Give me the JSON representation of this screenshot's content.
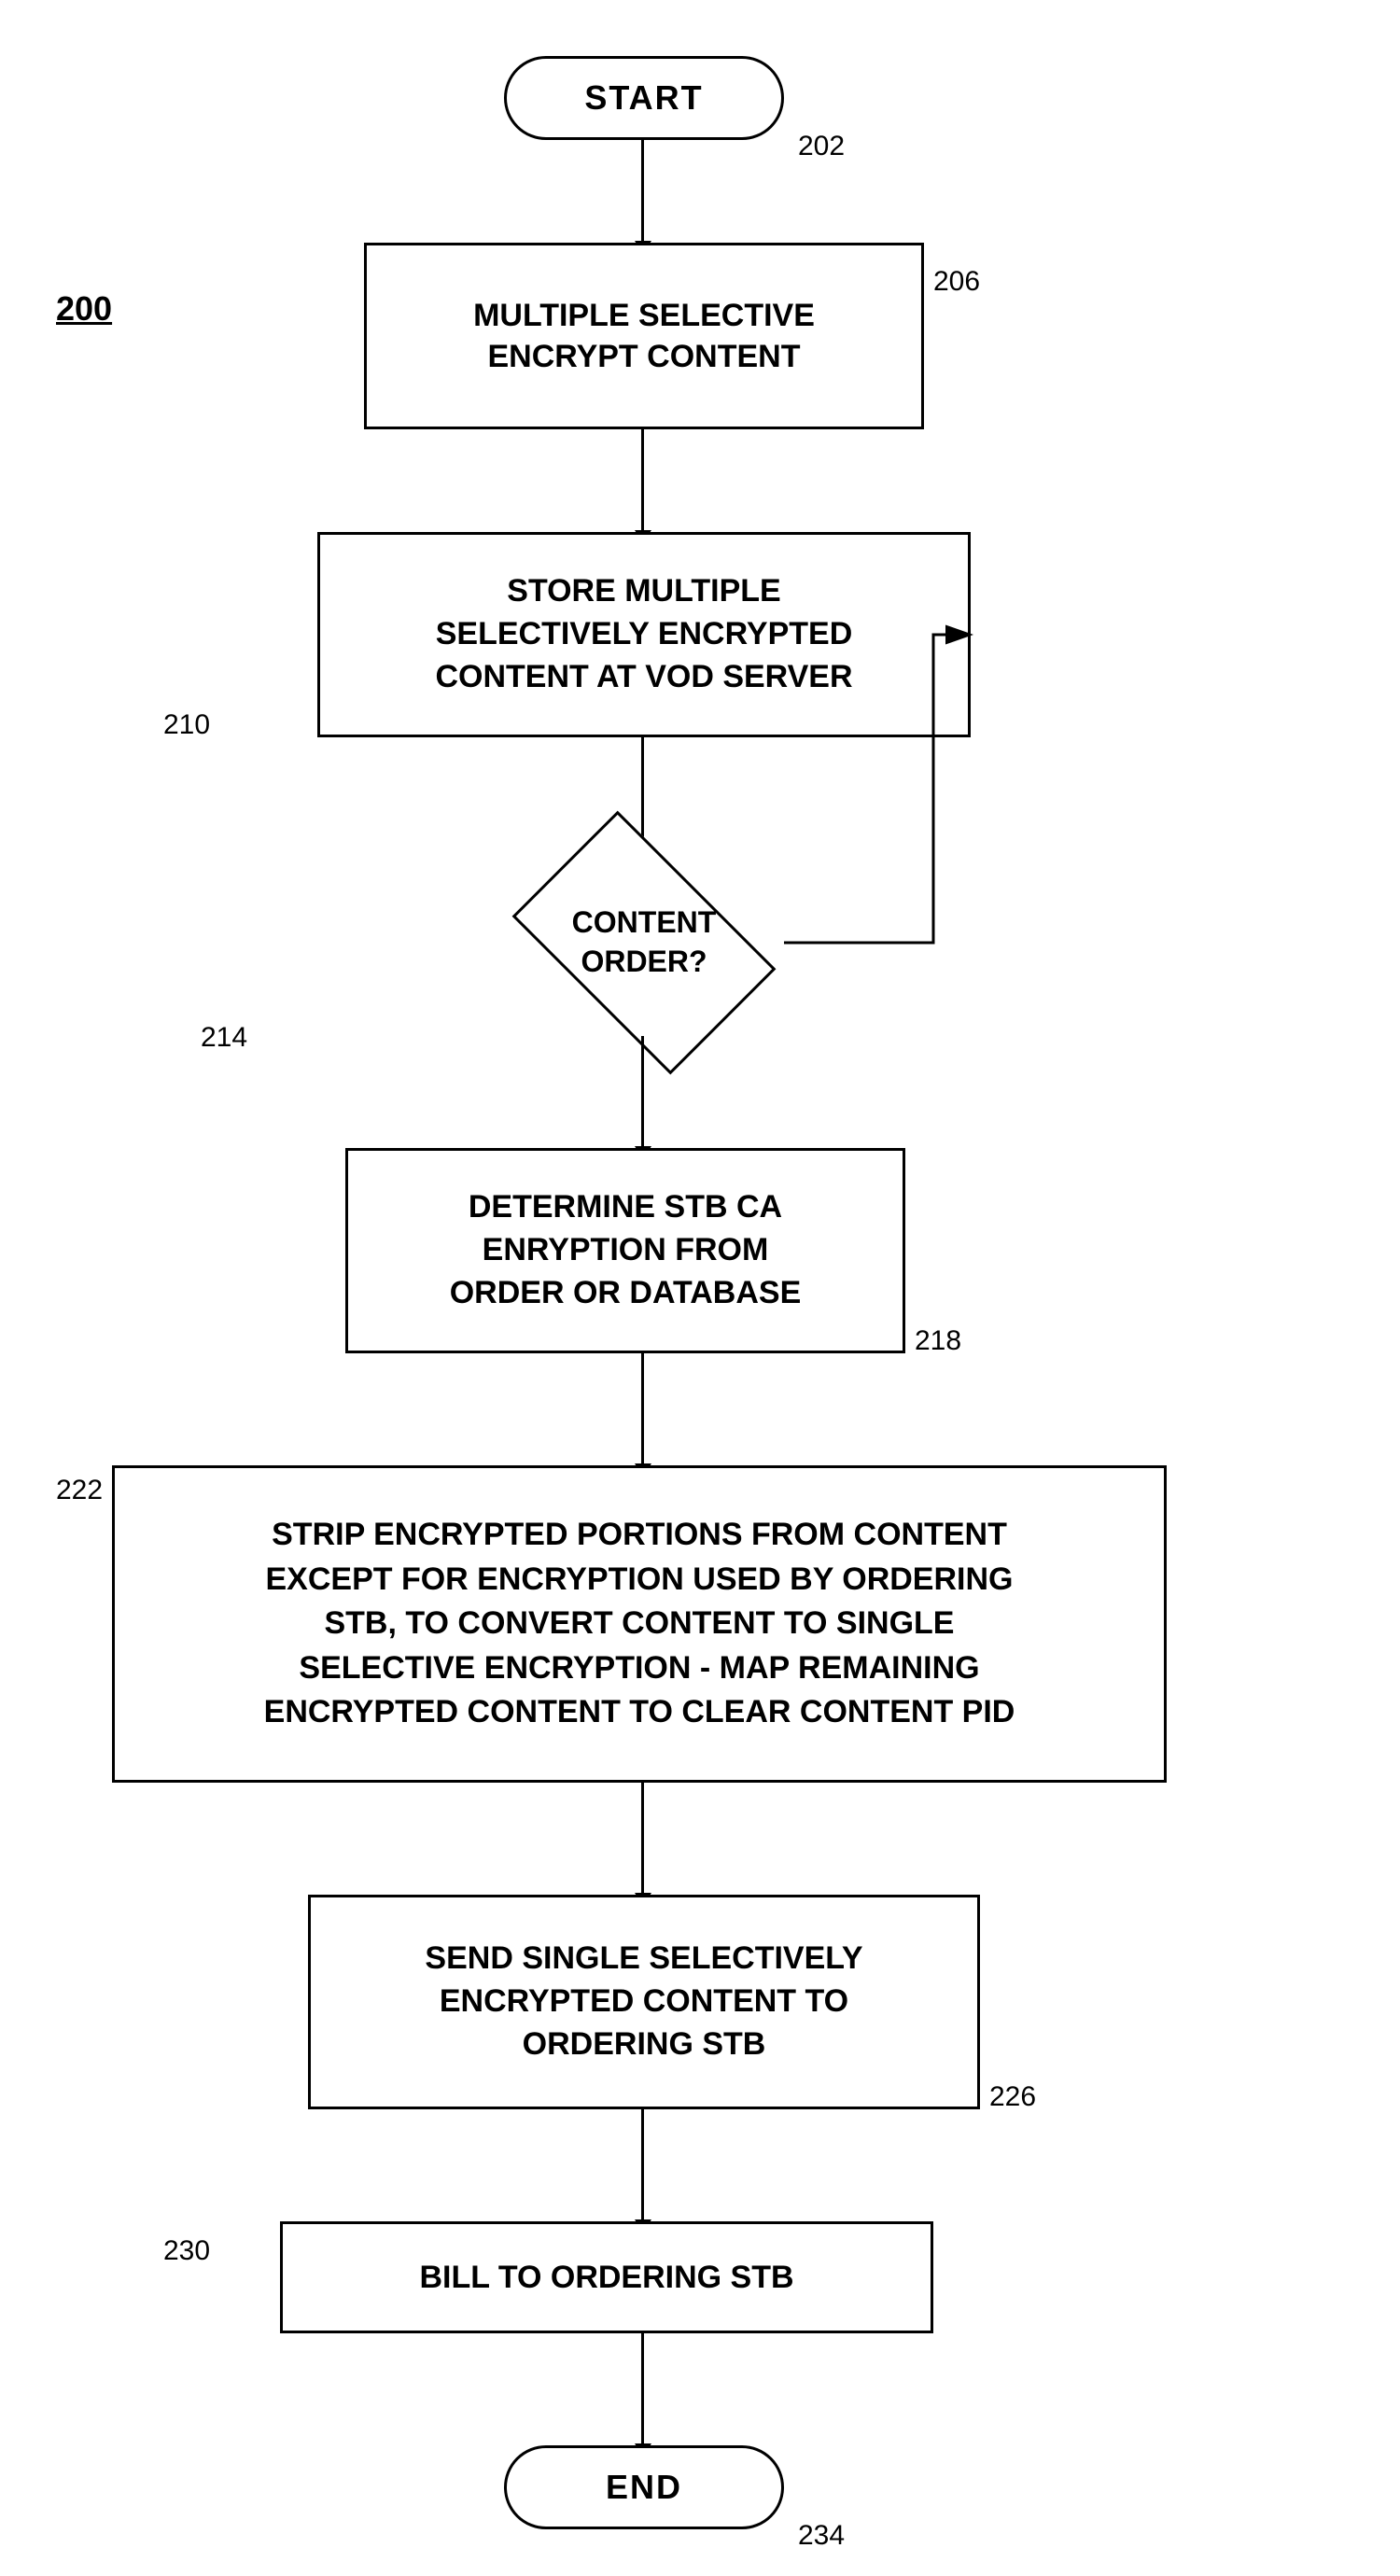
{
  "diagram": {
    "label": "200",
    "nodes": {
      "start": {
        "text": "START",
        "label": "202"
      },
      "box206": {
        "text": "MULTIPLE SELECTIVE\nENCRYPT CONTENT",
        "label": "206"
      },
      "box210": {
        "text": "STORE MULTIPLE\nSELECTIVELY ENCRYPTED\nCONTENT AT VOD SERVER",
        "label": "210"
      },
      "diamond214": {
        "text": "CONTENT\nORDER?",
        "label": "214"
      },
      "box218": {
        "text": "DETERMINE STB CA\nENRYPTION FROM\nORDER OR DATABASE",
        "label": "218"
      },
      "box222": {
        "text": "STRIP ENCRYPTED PORTIONS FROM CONTENT\nEXCEPT FOR ENCRYPTION USED BY ORDERING\nSTB, TO CONVERT CONTENT TO SINGLE\nSELECTIVE ENCRYPTION - MAP REMAINING\nENCRYPTED CONTENT TO CLEAR CONTENT PID",
        "label": "222"
      },
      "box226": {
        "text": "SEND SINGLE SELECTIVELY\nENCRYPTED CONTENT TO\nORDERING STB",
        "label": "226"
      },
      "box230": {
        "text": "BILL TO ORDERING STB",
        "label": "230"
      },
      "end": {
        "text": "END",
        "label": "234"
      }
    }
  }
}
